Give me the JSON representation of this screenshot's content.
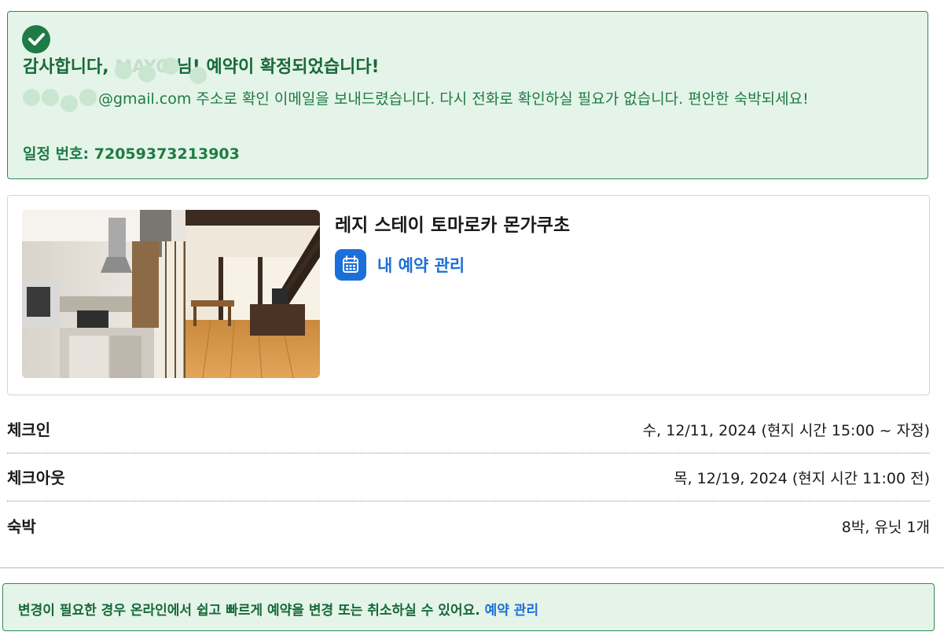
{
  "confirmation": {
    "title_prefix": "감사합니다, ",
    "title_name": "MAYO",
    "title_suffix": "님! 예약이 확정되었습니다!",
    "email_suffix": "@gmail.com",
    "message": " 주소로 확인 이메일을 보내드렸습니다. 다시 전화로 확인하실 필요가 없습니다. 편안한 숙박되세요!",
    "itinerary_label": "일정 번호:",
    "itinerary_number": "72059373213903"
  },
  "hotel": {
    "name": "레지 스테이 토마로카 몬가쿠초",
    "manage_label": "내 예약 관리"
  },
  "details": [
    {
      "label": "체크인",
      "value": "수, 12/11, 2024 (현지 시간 15:00 ~ 자정)"
    },
    {
      "label": "체크아웃",
      "value": "목, 12/19, 2024 (현지 시간 11:00 전)"
    },
    {
      "label": "숙박",
      "value": "8박, 유닛 1개"
    }
  ],
  "notice": {
    "text": "변경이 필요한 경우 온라인에서 쉽고 빠르게 예약을 변경 또는 취소하실 수 있어요.",
    "link_label": "예약 관리"
  },
  "colors": {
    "success_bg": "#e5f4e8",
    "success_text": "#16693a",
    "link_blue": "#1a6fd9"
  },
  "icons": [
    "check-circle-icon",
    "calendar-icon"
  ]
}
